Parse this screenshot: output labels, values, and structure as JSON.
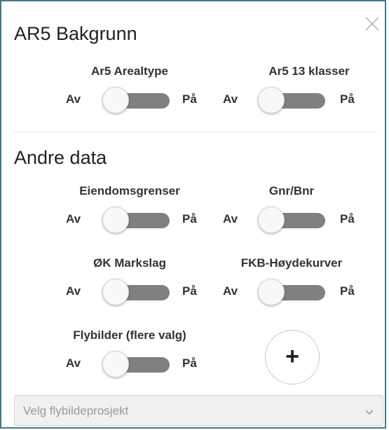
{
  "icons": {
    "close": "close-icon",
    "add": "plus-icon",
    "dropdown": "chevron-down-icon"
  },
  "colors": {
    "border": "#3f7b83",
    "track": "#808080",
    "knob": "#f8f8f8"
  },
  "sections": [
    {
      "title": "AR5 Bakgrunn",
      "toggles": [
        {
          "label": "Ar5 Arealtype",
          "off": "Av",
          "on": "På",
          "state": "off"
        },
        {
          "label": "Ar5 13 klasser",
          "off": "Av",
          "on": "På",
          "state": "off"
        }
      ]
    },
    {
      "title": "Andre data",
      "toggles": [
        {
          "label": "Eiendomsgrenser",
          "off": "Av",
          "on": "På",
          "state": "off"
        },
        {
          "label": "Gnr/Bnr",
          "off": "Av",
          "on": "På",
          "state": "off"
        },
        {
          "label": "ØK Markslag",
          "off": "Av",
          "on": "På",
          "state": "off"
        },
        {
          "label": "FKB-Høydekurver",
          "off": "Av",
          "on": "På",
          "state": "off"
        },
        {
          "label": "Flybilder (flere valg)",
          "off": "Av",
          "on": "På",
          "state": "off"
        }
      ]
    }
  ],
  "add_button": {
    "label": "+"
  },
  "select": {
    "placeholder": "Velg flybildeprosjekt"
  }
}
